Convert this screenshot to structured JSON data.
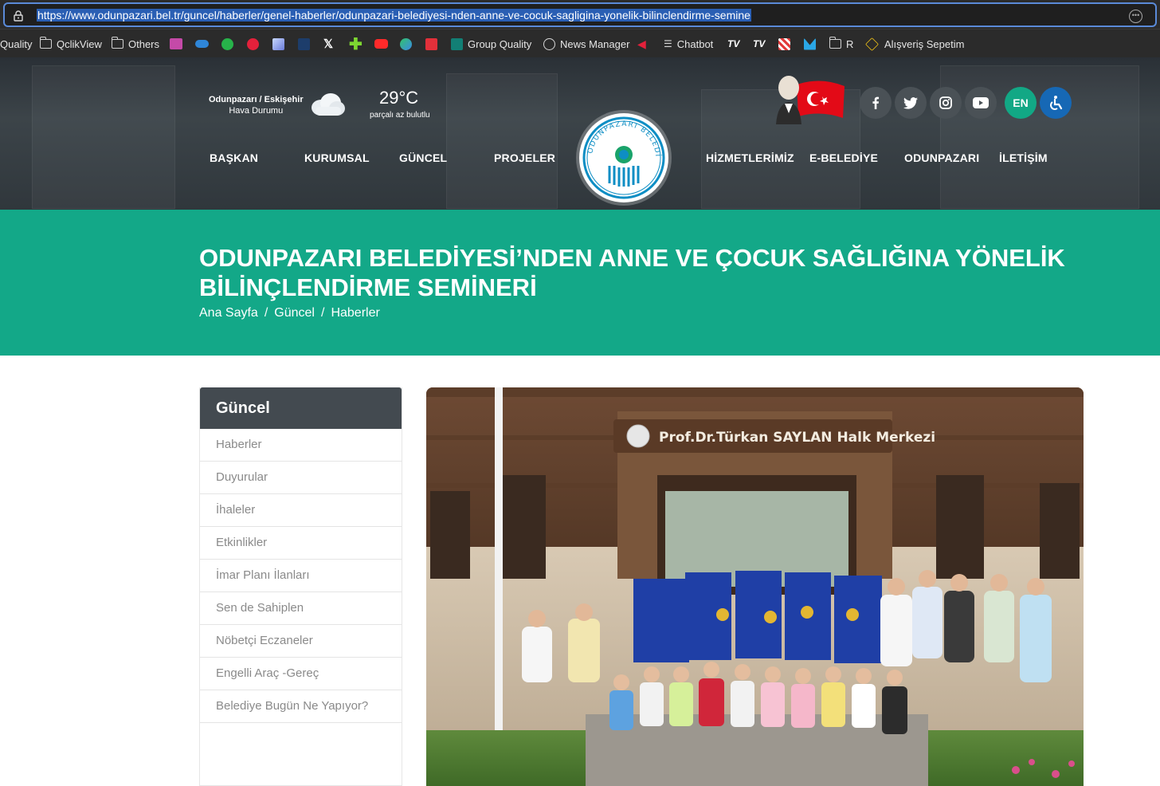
{
  "browser": {
    "url": "https://www.odunpazari.bel.tr/guncel/haberler/genel-haberler/odunpazari-belediyesi-nden-anne-ve-cocuk-sagligina-yonelik-bilinclendirme-semine",
    "bookmarks": {
      "quality": "Quality",
      "qlikview": "QclikView",
      "others": "Others",
      "group_quality": "Group Quality",
      "news_manager": "News Manager",
      "chatbot": "Chatbot",
      "r": "R",
      "cart": "Alışveriş Sepetim"
    }
  },
  "header": {
    "weather": {
      "location": "Odunpazarı / Eskişehir",
      "label": "Hava Durumu",
      "temperature": "29°C",
      "description": "parçalı az bulutlu"
    },
    "nav": {
      "baskan": "BAŞKAN",
      "kurumsal": "KURUMSAL",
      "guncel": "GÜNCEL",
      "projeler": "PROJELER",
      "hizmetlerimiz": "HİZMETLERİMİZ",
      "ebelediye": "E-BELEDİYE",
      "odunpazari": "ODUNPAZARI",
      "iletisim": "İLETİŞİM"
    },
    "logo_text": "ODUNPAZARI BELEDİYESİ",
    "language": "EN"
  },
  "page": {
    "title": "ODUNPAZARI BELEDİYESİ’NDEN ANNE VE ÇOCUK SAĞLIĞINA YÖNELİK BİLİNÇLENDİRME SEMİNERİ",
    "breadcrumb": [
      "Ana Sayfa",
      "Güncel",
      "Haberler"
    ]
  },
  "sidebar": {
    "title": "Güncel",
    "items": [
      "Haberler",
      "Duyurular",
      "İhaleler",
      "Etkinlikler",
      "İmar Planı İlanları",
      "Sen de Sahiplen",
      "Nöbetçi Eczaneler",
      "Engelli Araç -Gereç",
      "Belediye Bugün Ne Yapıyor?"
    ]
  },
  "photo": {
    "sign_text": "Prof.Dr.Türkan SAYLAN Halk Merkezi"
  },
  "colors": {
    "brand_green": "#13a888",
    "header_dark": "#434a50"
  }
}
